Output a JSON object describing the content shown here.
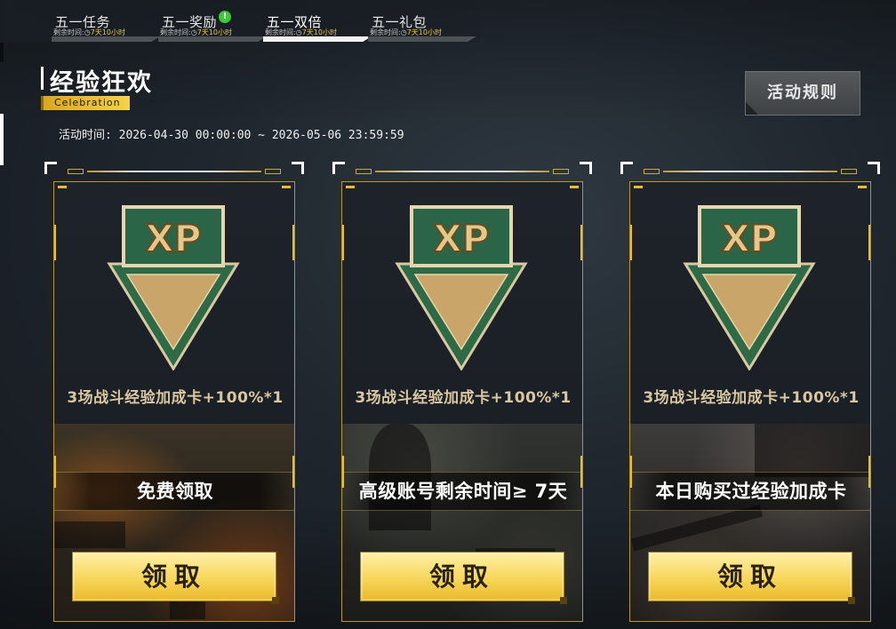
{
  "tabs": [
    {
      "label": "五一任务",
      "timer_prefix": "剩余时间:",
      "timer_value": "7天10小时",
      "active": false,
      "badge": ""
    },
    {
      "label": "五一奖励",
      "timer_prefix": "剩余时间:",
      "timer_value": "7天10小时",
      "active": false,
      "badge": "!"
    },
    {
      "label": "五一双倍",
      "timer_prefix": "剩余时间:",
      "timer_value": "7天10小时",
      "active": true,
      "badge": ""
    },
    {
      "label": "五一礼包",
      "timer_prefix": "剩余时间:",
      "timer_value": "7天10小时",
      "active": false,
      "badge": ""
    }
  ],
  "header": {
    "title": "经验狂欢",
    "subtitle": "Celebration",
    "date_range": "活动时间: 2026-04-30 00:00:00 ~ 2026-05-06 23:59:59",
    "rules_label": "活动规则"
  },
  "cards": [
    {
      "icon_text": "XP",
      "reward": "3场战斗经验加成卡+100%*1",
      "condition": "免费领取",
      "claim_label": "领取"
    },
    {
      "icon_text": "XP",
      "reward": "3场战斗经验加成卡+100%*1",
      "condition": "高级账号剩余时间≥ 7天",
      "claim_label": "领取"
    },
    {
      "icon_text": "XP",
      "reward": "3场战斗经验加成卡+100%*1",
      "condition": "本日购买过经验加成卡",
      "claim_label": "领取"
    }
  ],
  "colors": {
    "accent_gold": "#e8be2d",
    "badge_green": "#3ec73a",
    "xp_green": "#2e6b4a",
    "xp_tan": "#c9a66a"
  },
  "icons": {
    "clock": "clock-icon",
    "badge": "exclamation-badge-icon",
    "xp": "xp-arrow-icon"
  }
}
